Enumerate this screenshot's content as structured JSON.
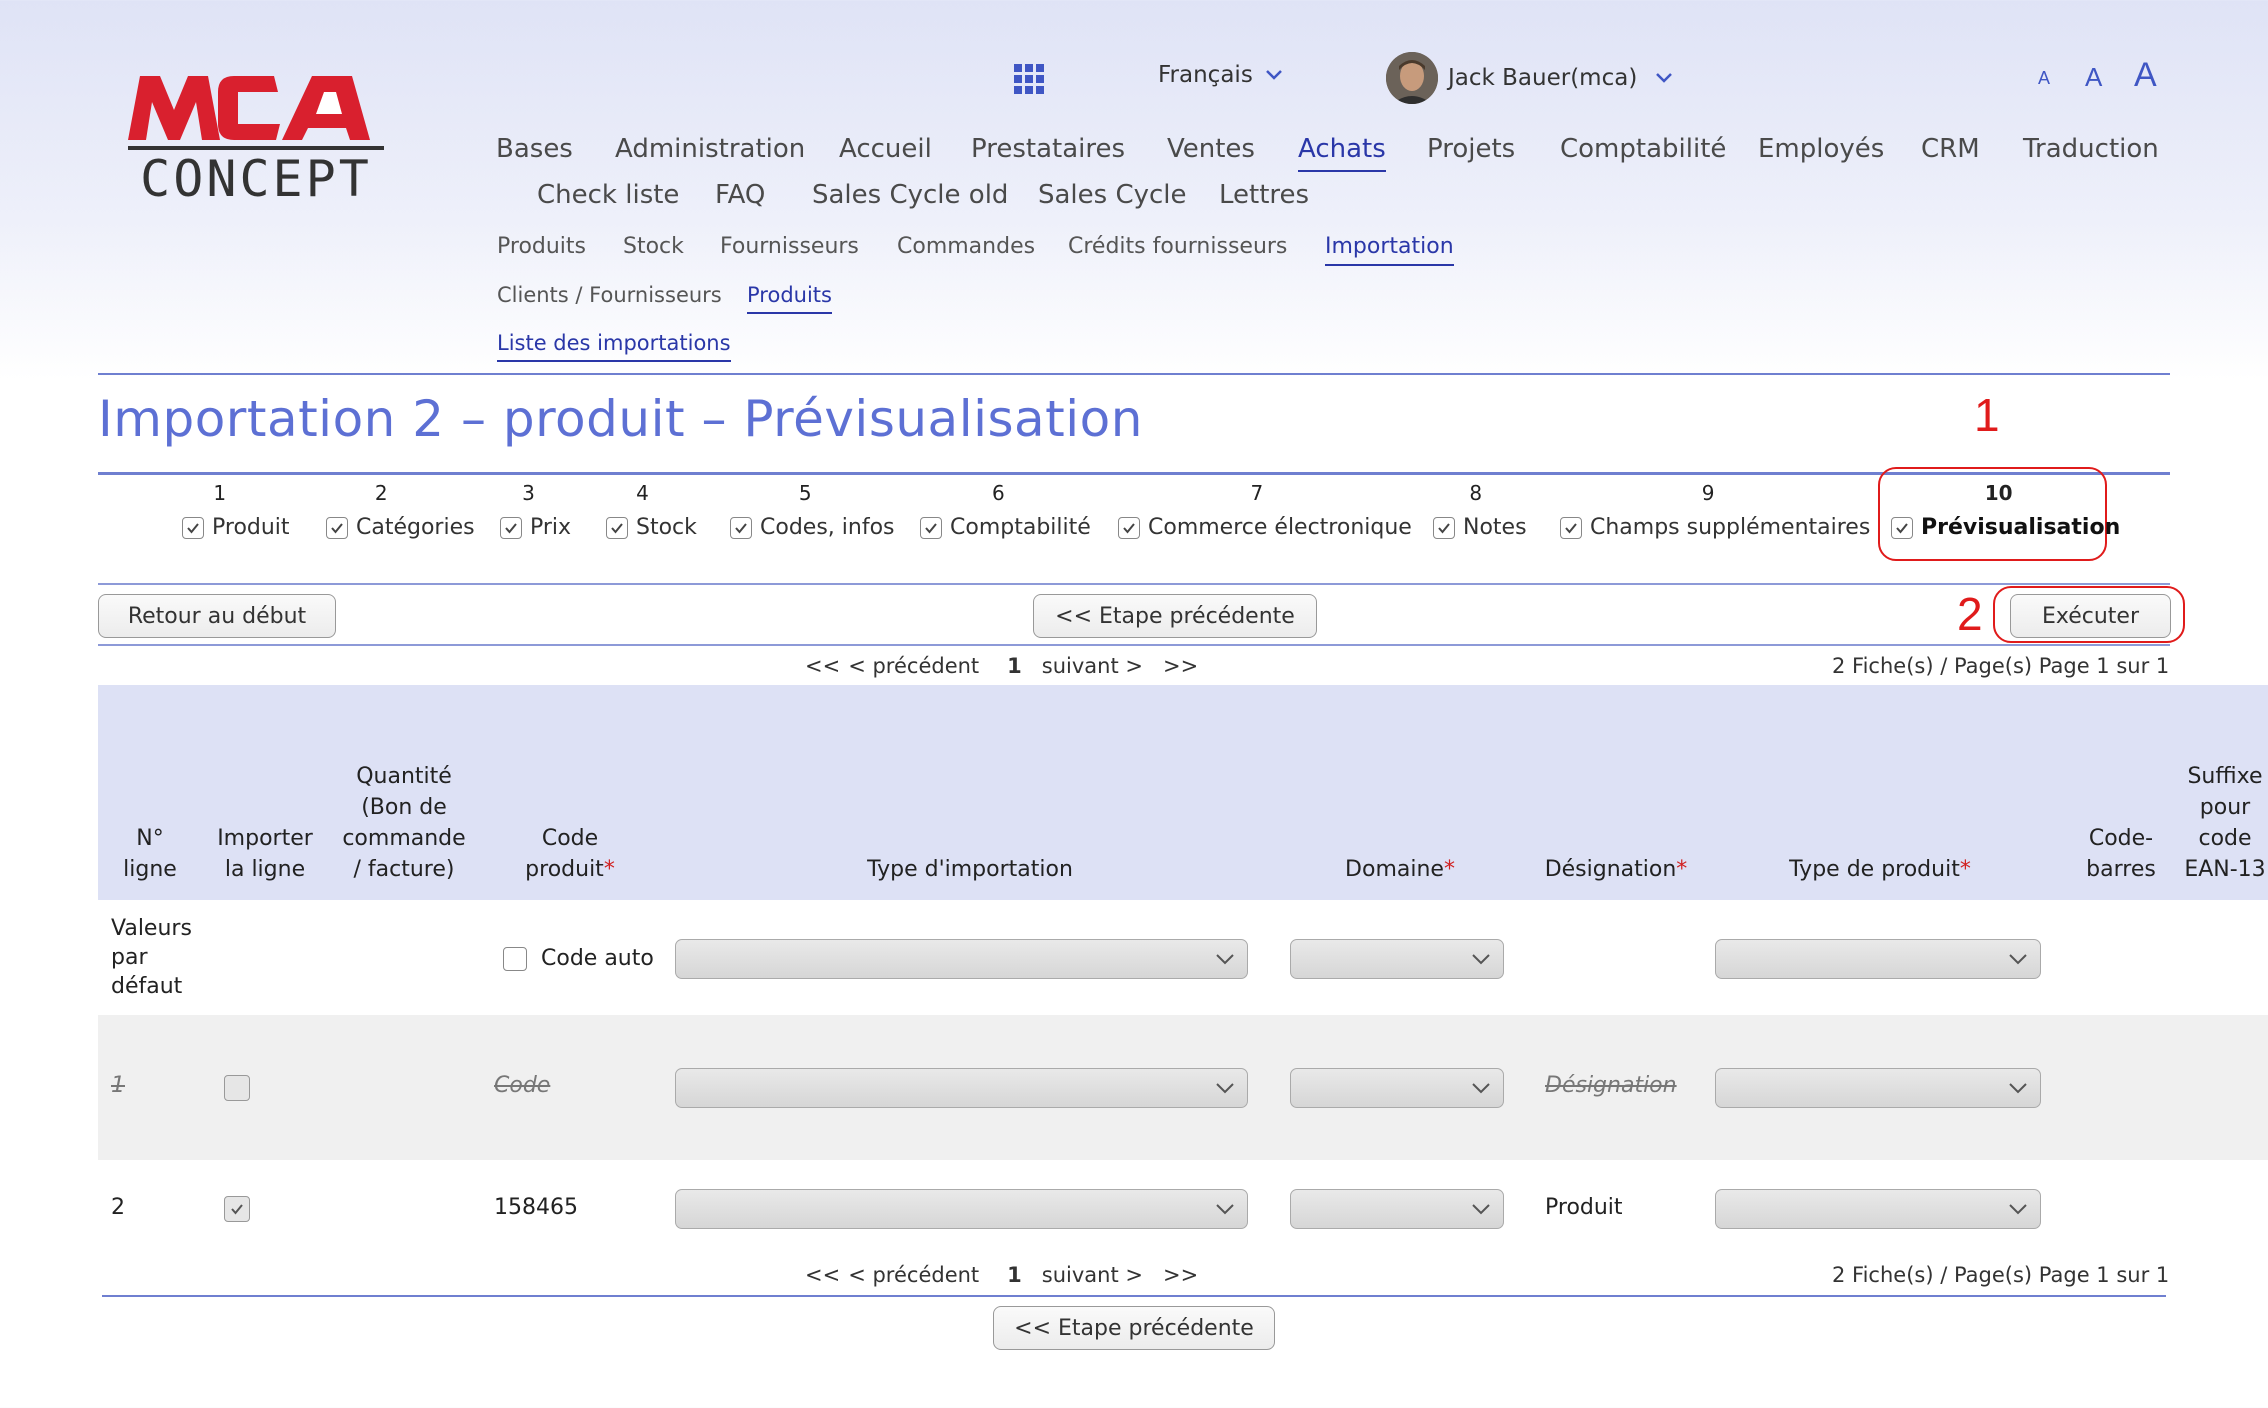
{
  "logo": {
    "top_text": "MCA",
    "bottom_text": "CONCEPT"
  },
  "topbar": {
    "language": "Français",
    "user": "Jack Bauer(mca)",
    "font_sizes": [
      "A",
      "A",
      "A"
    ]
  },
  "nav": {
    "main_row1": [
      "Bases",
      "Administration",
      "Accueil",
      "Prestataires",
      "Ventes",
      "Achats",
      "Projets",
      "Comptabilité",
      "Employés",
      "CRM",
      "Traduction"
    ],
    "main_row2": [
      "Check liste",
      "FAQ",
      "Sales Cycle old",
      "Sales Cycle",
      "Lettres"
    ],
    "active_main": "Achats",
    "sub1": [
      "Produits",
      "Stock",
      "Fournisseurs",
      "Commandes",
      "Crédits fournisseurs",
      "Importation"
    ],
    "active_sub1": "Importation",
    "sub2": [
      "Clients / Fournisseurs",
      "Produits"
    ],
    "active_sub2": "Produits",
    "sub3": [
      "Liste des importations"
    ]
  },
  "page_title": "Importation 2 – produit – Prévisualisation",
  "steps": [
    {
      "num": "1",
      "label": "Produit"
    },
    {
      "num": "2",
      "label": "Catégories"
    },
    {
      "num": "3",
      "label": "Prix"
    },
    {
      "num": "4",
      "label": "Stock"
    },
    {
      "num": "5",
      "label": "Codes, infos"
    },
    {
      "num": "6",
      "label": "Comptabilité"
    },
    {
      "num": "7",
      "label": "Commerce électronique"
    },
    {
      "num": "8",
      "label": "Notes"
    },
    {
      "num": "9",
      "label": "Champs supplémentaires"
    },
    {
      "num": "10",
      "label": "Prévisualisation"
    }
  ],
  "annotations": {
    "one": "1",
    "two": "2"
  },
  "buttons": {
    "restart": "Retour au début",
    "previous": "<< Etape précédente",
    "execute": "Exécuter"
  },
  "pager": {
    "first": "<<",
    "prev": "< précédent",
    "current": "1",
    "next": "suivant >",
    "last": ">>",
    "count": "2 Fiche(s) / Page(s) Page 1 sur 1"
  },
  "table": {
    "headers": {
      "line_no": "N° ligne",
      "import_line": "Importer la ligne",
      "quantity": "Quantité (Bon de commande / facture)",
      "product_code": "Code produit",
      "import_type": "Type d'importation",
      "domain": "Domaine",
      "designation": "Désignation",
      "product_type": "Type de produit",
      "barcode": "Code-barres",
      "ean_suffix": "Suffixe pour code EAN-13"
    },
    "defaults_row": {
      "label": "Valeurs par défaut",
      "code_auto": "Code auto"
    },
    "rows": [
      {
        "line": "1",
        "import": false,
        "code": "Code",
        "designation": "Désignation"
      },
      {
        "line": "2",
        "import": true,
        "code": "158465",
        "designation": "Produit"
      }
    ]
  },
  "colors": {
    "accent": "#2a37a8",
    "title": "#5d70d4",
    "annotation": "#e01b1b",
    "header_bg": "#dde1f5"
  }
}
